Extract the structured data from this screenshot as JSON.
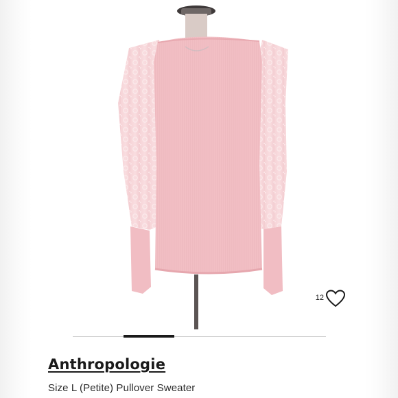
{
  "listing": {
    "brand": "Anthropologie",
    "subtitle": "Size L (Petite) Pullover Sweater",
    "like_count": "12"
  },
  "photo": {
    "description_color": "#f5c3c8",
    "carousel_total": 5,
    "carousel_active": 2
  },
  "icons": {
    "like": "heart-outline-icon"
  },
  "colors": {
    "garment": "#f4c6cb",
    "text": "#1a1a1a",
    "pager_active": "#1a1a1a",
    "pager_track": "#cfcfcf"
  }
}
